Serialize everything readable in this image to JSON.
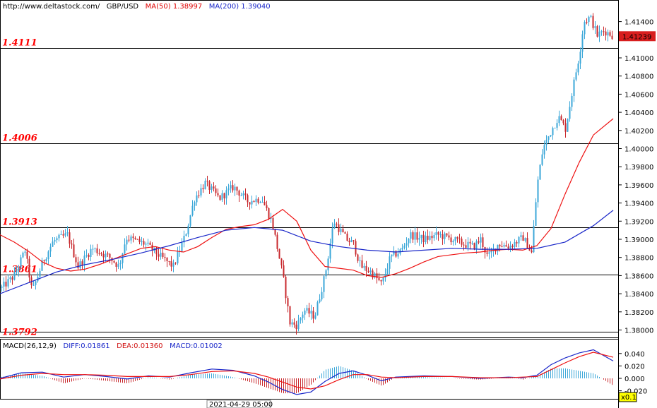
{
  "header": {
    "site": "http://www.deltastock.com/",
    "symbol": "GBP/USD",
    "ma50_label": "MA(50)",
    "ma50_value": "1.38997",
    "ma200_label": "MA(200)",
    "ma200_value": "1.39040"
  },
  "macd_header": {
    "name": "MACD(26,12,9)",
    "diff": "DIFF:0.01861",
    "dea": "DEA:0.01360",
    "macd": "MACD:0.01002"
  },
  "colors": {
    "bull": "#3ba7d8",
    "bear": "#c8282d",
    "ma50": "#ee1111",
    "ma200": "#1a27c9",
    "level": "#ff0000",
    "current_price_bg": "#d81e1e"
  },
  "current_price": "1.41239",
  "time_label": "2021-04-29 05:00",
  "zoom_label": "x0.1",
  "chart_data": [
    {
      "type": "candlestick",
      "ylim": [
        1.3792,
        1.416
      ],
      "y_ticks": [
        "1.41400",
        "1.41000",
        "1.40800",
        "1.40600",
        "1.40400",
        "1.40200",
        "1.40000",
        "1.39800",
        "1.39600",
        "1.39400",
        "1.39200",
        "1.39000",
        "1.38800",
        "1.38600",
        "1.38400",
        "1.38200",
        "1.38000"
      ],
      "levels": [
        {
          "value": 1.4111,
          "label": "1.4111"
        },
        {
          "value": 1.4006,
          "label": "1.4006"
        },
        {
          "value": 1.3913,
          "label": "1.3913"
        },
        {
          "value": 1.3861,
          "label": "1.3861"
        },
        {
          "value": 1.3792,
          "label": "1.3792"
        }
      ],
      "series": [
        {
          "name": "MA(50)",
          "x": [
            0,
            20,
            40,
            60,
            80,
            100,
            120,
            140,
            160,
            180,
            200,
            220,
            240,
            260,
            280,
            300,
            320,
            340,
            360,
            380,
            400,
            420,
            440,
            460,
            480,
            500,
            520,
            540,
            560,
            580,
            600,
            620,
            640,
            660,
            680,
            700,
            720,
            740,
            760,
            780,
            800,
            820,
            840,
            868
          ],
          "y": [
            1.3905,
            1.3897,
            1.3887,
            1.3875,
            1.3868,
            1.3865,
            1.3867,
            1.3872,
            1.3878,
            1.3884,
            1.389,
            1.3892,
            1.3888,
            1.3886,
            1.3892,
            1.3902,
            1.3911,
            1.3914,
            1.3916,
            1.3922,
            1.3933,
            1.392,
            1.3888,
            1.387,
            1.3868,
            1.3866,
            1.386,
            1.3858,
            1.3862,
            1.3868,
            1.3875,
            1.3881,
            1.3883,
            1.3885,
            1.3886,
            1.3888,
            1.3889,
            1.3888,
            1.3893,
            1.3912,
            1.395,
            1.3985,
            1.4015,
            1.4033
          ]
        },
        {
          "name": "MA(200)",
          "x": [
            0,
            40,
            80,
            120,
            160,
            200,
            240,
            280,
            320,
            360,
            400,
            440,
            480,
            520,
            560,
            600,
            640,
            680,
            720,
            760,
            800,
            840,
            868
          ],
          "y": [
            1.384,
            1.3852,
            1.3864,
            1.3872,
            1.3878,
            1.3885,
            1.3893,
            1.3902,
            1.391,
            1.3913,
            1.391,
            1.3898,
            1.3892,
            1.3888,
            1.3886,
            1.3888,
            1.389,
            1.3889,
            1.3889,
            1.389,
            1.3897,
            1.3915,
            1.3932
          ]
        }
      ],
      "candle_path": [
        [
          0,
          1.3845
        ],
        [
          20,
          1.386
        ],
        [
          35,
          1.3888
        ],
        [
          45,
          1.3842
        ],
        [
          60,
          1.3875
        ],
        [
          75,
          1.3898
        ],
        [
          95,
          1.3905
        ],
        [
          110,
          1.387
        ],
        [
          130,
          1.389
        ],
        [
          155,
          1.388
        ],
        [
          168,
          1.387
        ],
        [
          178,
          1.3902
        ],
        [
          205,
          1.3895
        ],
        [
          225,
          1.3882
        ],
        [
          245,
          1.387
        ],
        [
          262,
          1.3905
        ],
        [
          275,
          1.3945
        ],
        [
          290,
          1.3962
        ],
        [
          310,
          1.3945
        ],
        [
          330,
          1.3958
        ],
        [
          350,
          1.3942
        ],
        [
          370,
          1.3945
        ],
        [
          385,
          1.3918
        ],
        [
          400,
          1.386
        ],
        [
          410,
          1.3808
        ],
        [
          420,
          1.3805
        ],
        [
          430,
          1.3822
        ],
        [
          445,
          1.3815
        ],
        [
          460,
          1.3862
        ],
        [
          472,
          1.392
        ],
        [
          490,
          1.39
        ],
        [
          500,
          1.3895
        ],
        [
          510,
          1.387
        ],
        [
          525,
          1.3864
        ],
        [
          540,
          1.385
        ],
        [
          552,
          1.388
        ],
        [
          568,
          1.3888
        ],
        [
          580,
          1.3905
        ],
        [
          600,
          1.39
        ],
        [
          620,
          1.3905
        ],
        [
          640,
          1.39
        ],
        [
          655,
          1.3895
        ],
        [
          670,
          1.3892
        ],
        [
          680,
          1.39
        ],
        [
          690,
          1.388
        ],
        [
          705,
          1.3895
        ],
        [
          720,
          1.3892
        ],
        [
          740,
          1.3902
        ],
        [
          752,
          1.3885
        ],
        [
          760,
          1.396
        ],
        [
          768,
          1.4
        ],
        [
          780,
          1.402
        ],
        [
          790,
          1.4035
        ],
        [
          800,
          1.4022
        ],
        [
          810,
          1.4065
        ],
        [
          820,
          1.4105
        ],
        [
          826,
          1.414
        ],
        [
          835,
          1.4145
        ],
        [
          845,
          1.4125
        ],
        [
          855,
          1.413
        ],
        [
          868,
          1.4124
        ]
      ]
    },
    {
      "type": "macd",
      "ylim": [
        -0.026,
        0.048
      ],
      "y_ticks": [
        "0.040",
        "0.020",
        "0.000",
        "-0.020"
      ],
      "series": [
        {
          "name": "DIFF",
          "x": [
            0,
            30,
            60,
            90,
            120,
            150,
            180,
            210,
            240,
            270,
            300,
            330,
            360,
            380,
            400,
            420,
            440,
            460,
            480,
            500,
            520,
            540,
            560,
            600,
            640,
            680,
            700,
            720,
            740,
            760,
            780,
            800,
            820,
            840,
            868
          ],
          "y": [
            0.0,
            0.009,
            0.01,
            0.002,
            0.006,
            0.003,
            -0.001,
            0.004,
            0.002,
            0.009,
            0.015,
            0.013,
            0.004,
            -0.006,
            -0.018,
            -0.026,
            -0.022,
            -0.005,
            0.008,
            0.012,
            0.005,
            -0.004,
            0.002,
            0.004,
            0.003,
            0.0,
            0.001,
            0.002,
            0.001,
            0.005,
            0.022,
            0.033,
            0.041,
            0.046,
            0.028
          ]
        },
        {
          "name": "DEA",
          "x": [
            0,
            30,
            60,
            90,
            120,
            150,
            180,
            210,
            240,
            270,
            300,
            330,
            360,
            380,
            400,
            420,
            440,
            460,
            480,
            500,
            520,
            540,
            560,
            600,
            640,
            680,
            700,
            720,
            740,
            760,
            780,
            800,
            820,
            840,
            868
          ],
          "y": [
            -0.001,
            0.005,
            0.008,
            0.006,
            0.006,
            0.005,
            0.003,
            0.003,
            0.003,
            0.006,
            0.011,
            0.012,
            0.008,
            0.002,
            -0.006,
            -0.014,
            -0.017,
            -0.012,
            -0.002,
            0.006,
            0.006,
            0.002,
            0.001,
            0.003,
            0.003,
            0.001,
            0.001,
            0.001,
            0.002,
            0.003,
            0.014,
            0.025,
            0.035,
            0.042,
            0.034
          ]
        }
      ]
    }
  ]
}
